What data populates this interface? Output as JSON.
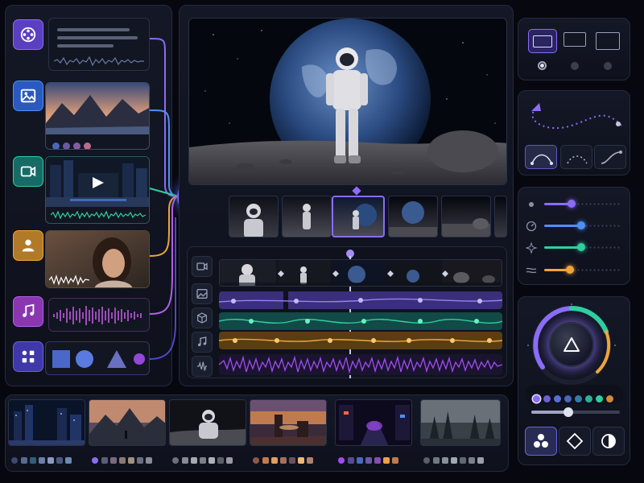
{
  "app": {
    "title": ""
  },
  "colors": {
    "background": "#07080f",
    "panel": "#121622",
    "accent_purple": "#8b6cf6",
    "accent_blue": "#4f8ff7",
    "accent_teal": "#2fcf9f",
    "accent_orange": "#f0a53a",
    "accent_violet": "#b260e6"
  },
  "inputs": {
    "items": [
      {
        "name": "text",
        "icon": "text-layout-icon",
        "color": "#6b4fd8"
      },
      {
        "name": "image",
        "icon": "image-icon",
        "color": "#3b6fd4"
      },
      {
        "name": "video",
        "icon": "video-camera-icon",
        "color": "#1f8f86"
      },
      {
        "name": "person",
        "icon": "user-icon",
        "color": "#c98a2e"
      },
      {
        "name": "audio",
        "icon": "music-note-icon",
        "color": "#9b3fc8"
      },
      {
        "name": "shapes",
        "icon": "grid-icon",
        "color": "#5048c8"
      }
    ]
  },
  "hub": {
    "icon": "sparkle-icon"
  },
  "timeline": {
    "tracks": [
      {
        "name": "video-track",
        "icon": "video-camera-icon",
        "color": "#5a6078"
      },
      {
        "name": "image-track",
        "icon": "image-icon",
        "color": "#8b6cf6"
      },
      {
        "name": "3d-track",
        "icon": "cube-icon",
        "color": "#2fcf9f"
      },
      {
        "name": "music-track",
        "icon": "music-note-icon",
        "color": "#f0a53a"
      },
      {
        "name": "audio-track",
        "icon": "waveform-icon",
        "color": "#a24cf0"
      }
    ],
    "playhead_position": 0.46
  },
  "aspect": {
    "options": [
      "wide",
      "landscape",
      "landscape-alt"
    ],
    "selected": 0
  },
  "path_tools": {
    "options": [
      "arc-curve",
      "dotted-curve",
      "ease-curve"
    ],
    "selected": 0
  },
  "sliders": [
    {
      "name": "light",
      "icon": "dot-icon",
      "color": "#8b6cf6",
      "value": 0.35
    },
    {
      "name": "speed",
      "icon": "speedometer-icon",
      "color": "#4f8ff7",
      "value": 0.48
    },
    {
      "name": "sparkle",
      "icon": "sparkle-icon",
      "color": "#2fcf9f",
      "value": 0.48
    },
    {
      "name": "wind",
      "icon": "wind-icon",
      "color": "#f0a53a",
      "value": 0.33
    }
  ],
  "dial": {
    "icon": "play-triangle-icon",
    "swatches": [
      "#8b6cf6",
      "#6a62d0",
      "#5570d8",
      "#4a68b8",
      "#3a7aa8",
      "#2fb09a",
      "#2fcf9f",
      "#d08a3a"
    ],
    "intensity": 0.42,
    "modes": [
      {
        "icon": "circles-icon",
        "selected": true
      },
      {
        "icon": "diamond-icon",
        "selected": false
      },
      {
        "icon": "contrast-icon",
        "selected": false
      }
    ]
  },
  "gallery": {
    "thumbnails": [
      {
        "name": "city-night",
        "palette": [
          "#3b4a6e",
          "#5a6a90",
          "#2f5f7a",
          "#6c7fa8",
          "#8a9bc0",
          "#4a5a80",
          "#6a8ab0"
        ]
      },
      {
        "name": "mountain-sunset",
        "palette": [
          "#8b6cf6",
          "#5a5f78",
          "#7a6a80",
          "#8a7a70",
          "#a09080",
          "#6a7080",
          "#8a8a98"
        ]
      },
      {
        "name": "astronaut",
        "palette": [
          "#6a7080",
          "#8a8a90",
          "#a8a8b0",
          "#7a7f88",
          "#b0b0b8",
          "#5a6068",
          "#9a9aa0"
        ]
      },
      {
        "name": "desert-dusk",
        "palette": [
          "#8a5a48",
          "#c07a50",
          "#e0a060",
          "#a07060",
          "#6a5060",
          "#f0b878",
          "#b08070"
        ]
      },
      {
        "name": "neon-street",
        "palette": [
          "#a24cf0",
          "#5a4a90",
          "#4a68c0",
          "#6a5aa0",
          "#8a4ab0",
          "#f0a040",
          "#c07a50"
        ]
      },
      {
        "name": "misty-forest",
        "palette": [
          "#5a6068",
          "#707880",
          "#8a9098",
          "#a0a8b0",
          "#606870",
          "#7a8088",
          "#9aa0a8"
        ]
      }
    ]
  }
}
